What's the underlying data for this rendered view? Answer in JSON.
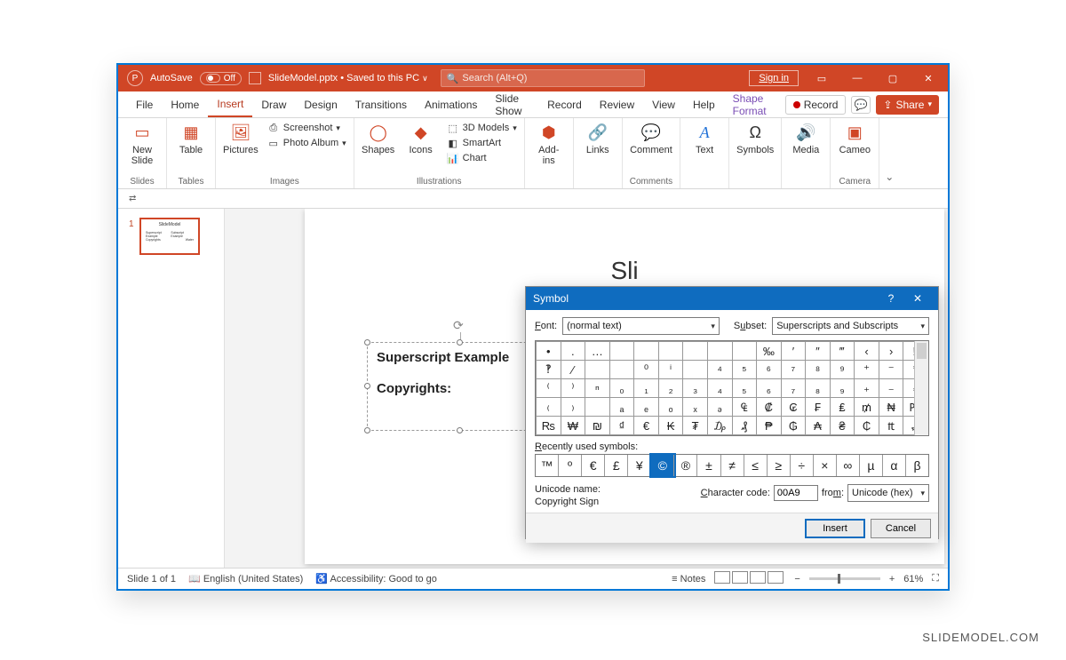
{
  "titlebar": {
    "autosave_label": "AutoSave",
    "autosave_state": "Off",
    "filename": "SlideModel.pptx",
    "saved_status": "Saved to this PC",
    "search_placeholder": "Search (Alt+Q)",
    "signin": "Sign in"
  },
  "tabs": {
    "file": "File",
    "home": "Home",
    "insert": "Insert",
    "draw": "Draw",
    "design": "Design",
    "transitions": "Transitions",
    "animations": "Animations",
    "slideshow": "Slide Show",
    "record": "Record",
    "review": "Review",
    "view": "View",
    "help": "Help",
    "shapeformat": "Shape Format",
    "record_btn": "Record",
    "share": "Share"
  },
  "ribbon": {
    "slides": {
      "new_slide": "New\nSlide",
      "group": "Slides"
    },
    "tables": {
      "table": "Table",
      "group": "Tables"
    },
    "images": {
      "pictures": "Pictures",
      "screenshot": "Screenshot",
      "album": "Photo Album",
      "group": "Images"
    },
    "illus": {
      "shapes": "Shapes",
      "icons": "Icons",
      "models": "3D Models",
      "smartart": "SmartArt",
      "chart": "Chart",
      "group": "Illustrations"
    },
    "addins": {
      "addins": "Add-\nins",
      "group": ""
    },
    "links": {
      "links": "Links",
      "group": ""
    },
    "comments": {
      "comment": "Comment",
      "group": "Comments"
    },
    "text": {
      "text": "Text",
      "group": ""
    },
    "symbols": {
      "symbols": "Symbols",
      "group": ""
    },
    "media": {
      "media": "Media",
      "group": ""
    },
    "camera": {
      "cameo": "Cameo",
      "group": "Camera"
    }
  },
  "thumb": {
    "num": "1",
    "title": "SlideModel",
    "l1": "Superscript Example",
    "l2": "Subscript Example",
    "l3": "Copyrights",
    "l4": "Water"
  },
  "slide": {
    "title_fragment": "Sli",
    "textbox": {
      "line1": "Superscript Example",
      "line2": "Copyrights:"
    }
  },
  "dialog": {
    "title": "Symbol",
    "font_label": "Font:",
    "font_value": "(normal text)",
    "subset_label": "Subset:",
    "subset_value": "Superscripts and Subscripts",
    "grid": [
      [
        "•",
        ".",
        "…",
        "",
        "",
        "",
        "",
        "",
        "",
        "‰",
        "′",
        "″",
        "‴",
        "‹",
        "›",
        "‼"
      ],
      [
        "‽",
        "⁄",
        "",
        "",
        "⁰",
        "ⁱ",
        "",
        "⁴",
        "⁵",
        "⁶",
        "⁷",
        "⁸",
        "⁹",
        "⁺",
        "⁻",
        "⁼"
      ],
      [
        "⁽",
        "⁾",
        "ⁿ",
        "₀",
        "₁",
        "₂",
        "₃",
        "₄",
        "₅",
        "₆",
        "₇",
        "₈",
        "₉",
        "₊",
        "₋",
        "₌"
      ],
      [
        "₍",
        "₎",
        "",
        "ₐ",
        "ₑ",
        "ₒ",
        "ₓ",
        "ₔ",
        "₠",
        "₡",
        "₢",
        "₣",
        "₤",
        "₥",
        "₦",
        "₧"
      ],
      [
        "₨",
        "₩",
        "₪",
        "₫",
        "€",
        "₭",
        "₮",
        "₯",
        "₰",
        "₱",
        "₲",
        "₳",
        "₴",
        "₵",
        "₶",
        "₷"
      ]
    ],
    "recent_label": "Recently used symbols:",
    "recent": [
      "™",
      "º",
      "€",
      "£",
      "¥",
      "©",
      "®",
      "±",
      "≠",
      "≤",
      "≥",
      "÷",
      "×",
      "∞",
      "µ",
      "α",
      "β"
    ],
    "recent_selected_index": 5,
    "unicode_name_label": "Unicode name:",
    "unicode_name_value": "Copyright Sign",
    "char_code_label": "Character code:",
    "char_code_value": "00A9",
    "from_label": "from:",
    "from_value": "Unicode (hex)",
    "insert": "Insert",
    "cancel": "Cancel"
  },
  "status": {
    "slide": "Slide 1 of 1",
    "lang": "English (United States)",
    "a11y": "Accessibility: Good to go",
    "notes": "Notes",
    "zoom": "61%"
  },
  "watermark": "SLIDEMODEL.COM"
}
